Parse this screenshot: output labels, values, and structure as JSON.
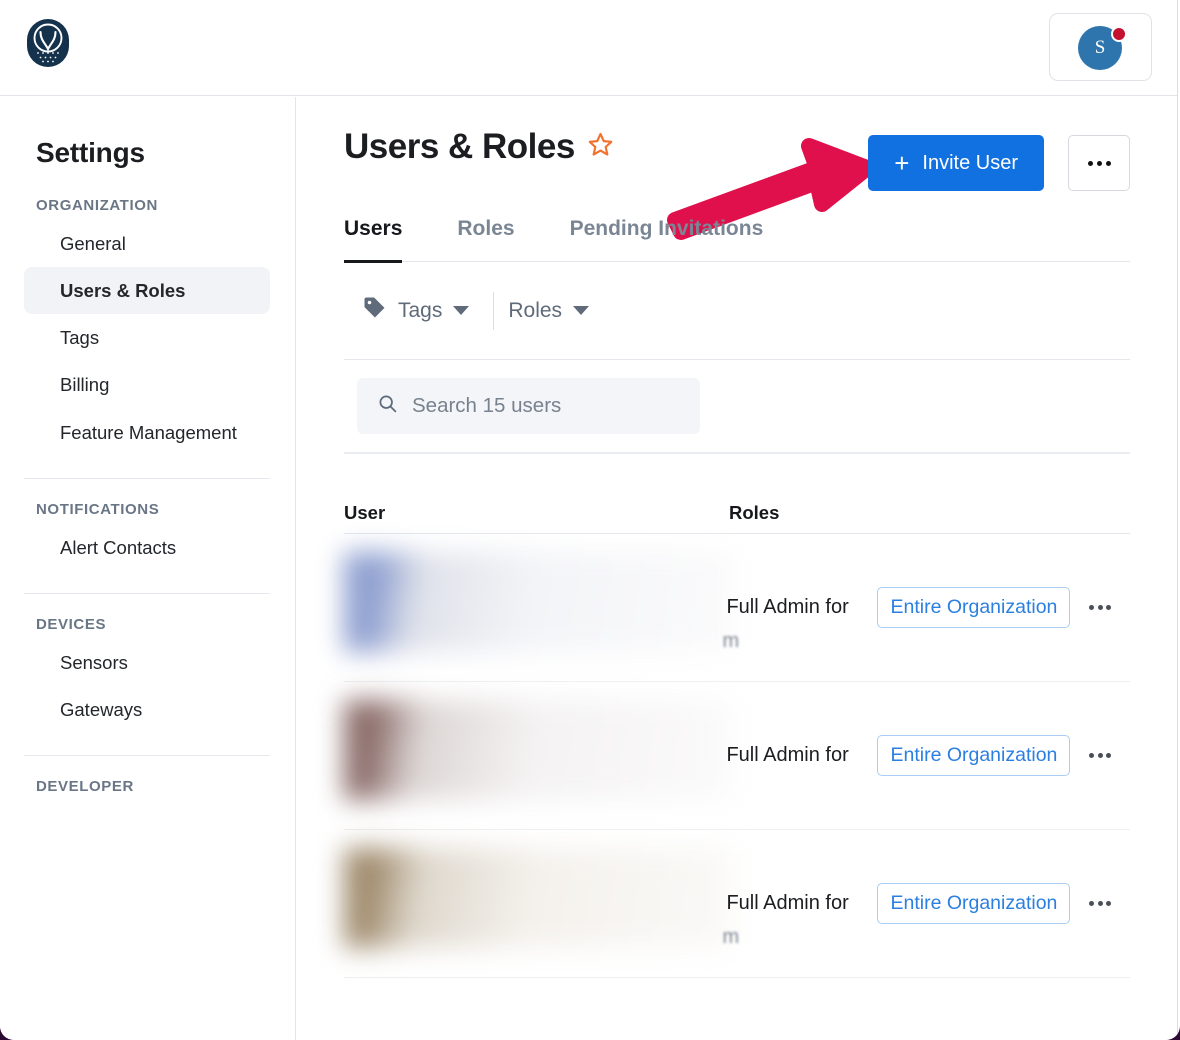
{
  "topbar": {
    "logo_icon": "owl-logo-icon",
    "avatar_initial": "S",
    "notification_dot": "notification-dot"
  },
  "sidebar": {
    "title": "Settings",
    "groups": [
      {
        "label": "ORGANIZATION",
        "items": [
          {
            "label": "General",
            "active": false
          },
          {
            "label": "Users & Roles",
            "active": true
          },
          {
            "label": "Tags",
            "active": false
          },
          {
            "label": "Billing",
            "active": false
          },
          {
            "label": "Feature Management",
            "active": false
          }
        ]
      },
      {
        "label": "NOTIFICATIONS",
        "items": [
          {
            "label": "Alert Contacts",
            "active": false
          }
        ]
      },
      {
        "label": "DEVICES",
        "items": [
          {
            "label": "Sensors",
            "active": false
          },
          {
            "label": "Gateways",
            "active": false
          }
        ]
      },
      {
        "label": "DEVELOPER",
        "items": []
      }
    ]
  },
  "page": {
    "title": "Users & Roles",
    "favorite_icon": "star-outline-icon",
    "invite_label": "Invite User",
    "invite_plus": "+",
    "more_label": "•••"
  },
  "tabs": [
    {
      "label": "Users",
      "active": true
    },
    {
      "label": "Roles",
      "active": false
    },
    {
      "label": "Pending Invitations",
      "active": false
    }
  ],
  "filters": [
    {
      "label": "Tags",
      "icon": "tag-icon"
    },
    {
      "label": "Roles",
      "icon": ""
    }
  ],
  "search": {
    "placeholder": "Search 15 users",
    "value": "",
    "icon": "search-icon"
  },
  "table": {
    "columns": [
      "User",
      "Roles"
    ],
    "rows": [
      {
        "user": "",
        "user_redacted": true,
        "role": "Full Admin for",
        "scope": "Entire Organization",
        "tint": "blur-a"
      },
      {
        "user": "",
        "user_redacted": true,
        "role": "Full Admin for",
        "scope": "Entire Organization",
        "tint": "blur-b"
      },
      {
        "user": "",
        "user_redacted": true,
        "role": "Full Admin for",
        "scope": "Entire Organization",
        "tint": "blur-c"
      }
    ]
  },
  "annotation": {
    "type": "arrow",
    "color": "#e0104c",
    "points_at": "invite-user-button"
  },
  "colors": {
    "primary": "#1271e0",
    "accent_star": "#f2712c",
    "chip_text": "#2a7fe0",
    "logo": "#14324c",
    "arrow": "#e0104c"
  }
}
